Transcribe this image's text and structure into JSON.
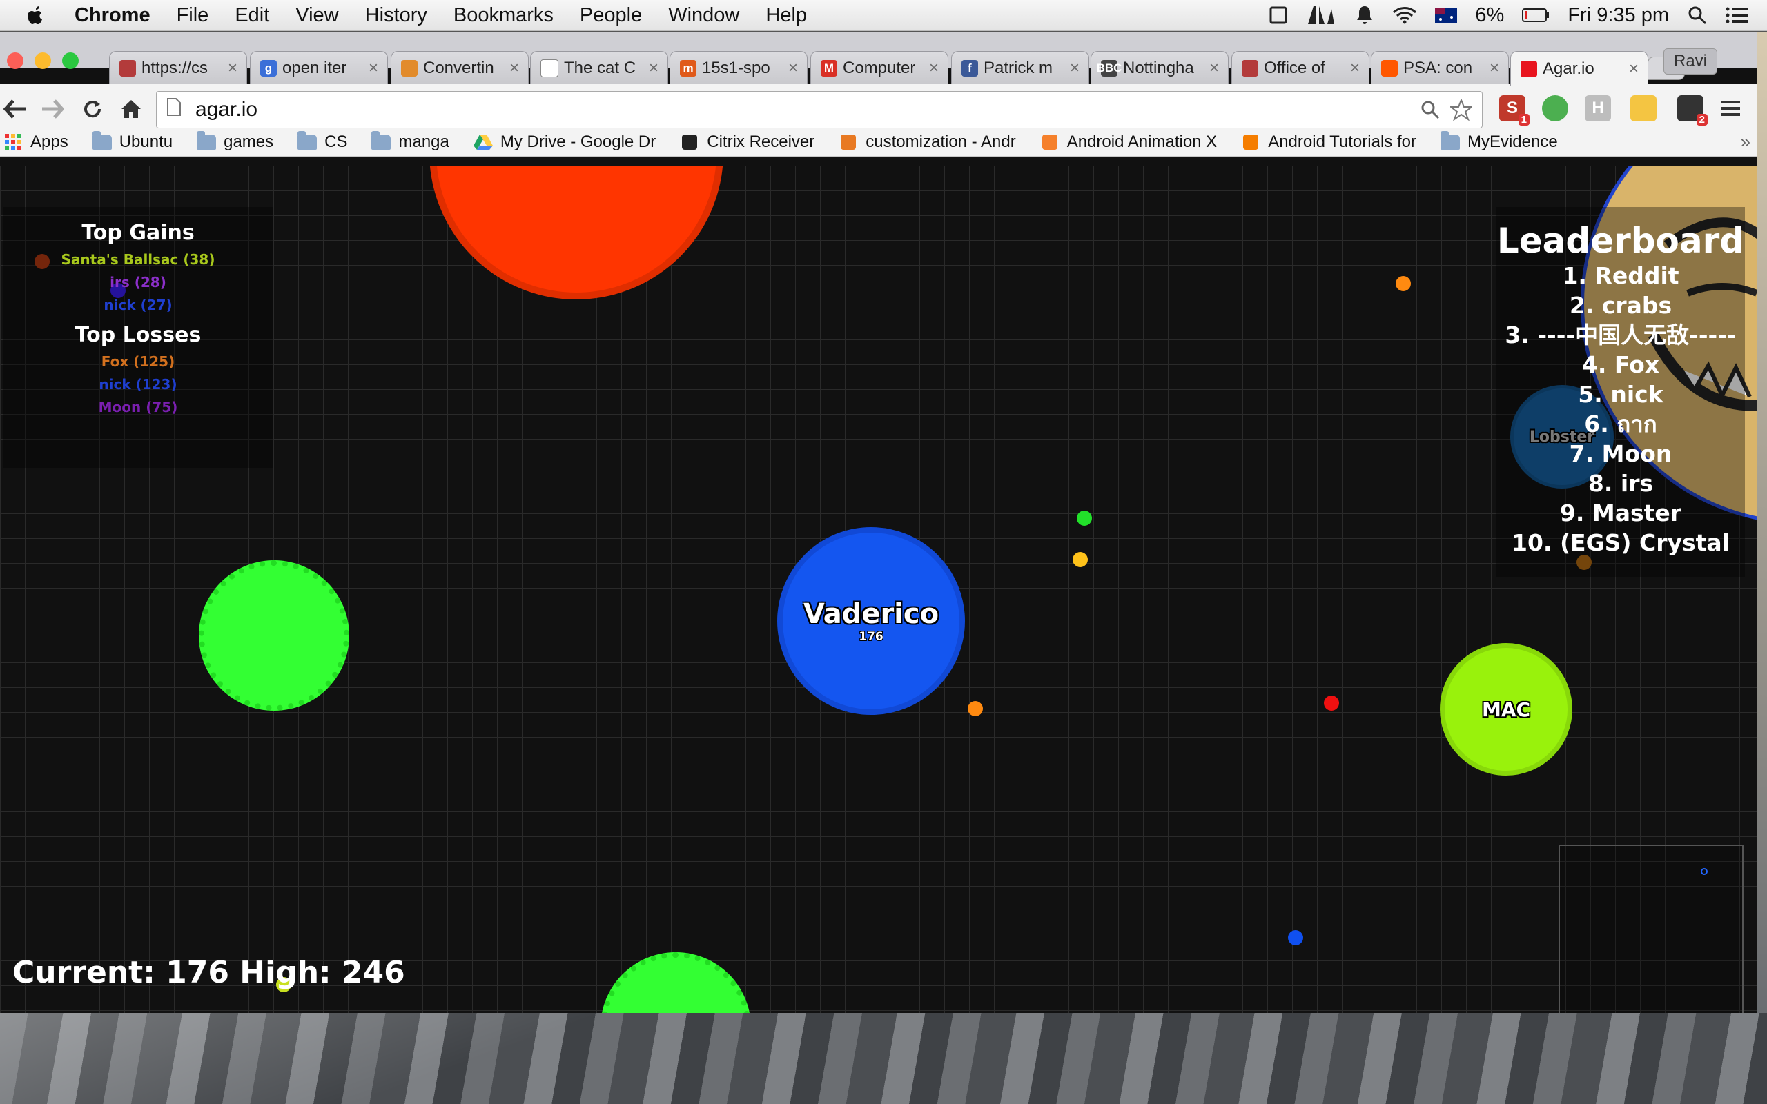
{
  "menubar": {
    "app_name": "Chrome",
    "menus": [
      "File",
      "Edit",
      "View",
      "History",
      "Bookmarks",
      "People",
      "Window",
      "Help"
    ],
    "battery": "6%",
    "clock": "Fri 9:35 pm"
  },
  "tabs": [
    {
      "title": "https://cs",
      "favicon_color": "#b33b3b",
      "favicon_glyph": ""
    },
    {
      "title": "open iter",
      "favicon_color": "#3b6fd8",
      "favicon_glyph": "g"
    },
    {
      "title": "Convertin",
      "favicon_color": "#e28b2b",
      "favicon_glyph": ""
    },
    {
      "title": "The cat C",
      "favicon_color": "#ffffff",
      "favicon_glyph": ""
    },
    {
      "title": "15s1-spo",
      "favicon_color": "#e05a1a",
      "favicon_glyph": "m"
    },
    {
      "title": "Computer",
      "favicon_color": "#d93025",
      "favicon_glyph": "M"
    },
    {
      "title": "Patrick m",
      "favicon_color": "#3b5998",
      "favicon_glyph": "f"
    },
    {
      "title": "Nottingha",
      "favicon_color": "#444444",
      "favicon_glyph": "BBC"
    },
    {
      "title": "Office of",
      "favicon_color": "#b33b3b",
      "favicon_glyph": ""
    },
    {
      "title": "PSA: con",
      "favicon_color": "#ff5700",
      "favicon_glyph": ""
    },
    {
      "title": "Agar.io",
      "favicon_color": "#e8141e",
      "favicon_glyph": "",
      "active": true
    }
  ],
  "profile_name": "Ravi",
  "address": {
    "url": "agar.io"
  },
  "extensions": [
    {
      "glyph": "S",
      "color": "#c0392b",
      "badge": "1"
    },
    {
      "glyph": "",
      "color": "#4caf50",
      "badge": ""
    },
    {
      "glyph": "H",
      "color": "#bdbdbd",
      "badge": ""
    },
    {
      "glyph": "",
      "color": "#f4c542",
      "badge": ""
    },
    {
      "glyph": "",
      "color": "#333333",
      "badge": "2"
    }
  ],
  "bookmarks": [
    {
      "label": "Apps",
      "icon": "apps-grid-icon"
    },
    {
      "label": "Ubuntu",
      "icon": "folder-icon"
    },
    {
      "label": "games",
      "icon": "folder-icon"
    },
    {
      "label": "CS",
      "icon": "folder-icon"
    },
    {
      "label": "manga",
      "icon": "folder-icon"
    },
    {
      "label": "My Drive - Google Dr",
      "icon": "google-drive-icon"
    },
    {
      "label": "Citrix Receiver",
      "icon": "citrix-icon"
    },
    {
      "label": "customization - Andr",
      "icon": "stackoverflow-icon"
    },
    {
      "label": "Android Animation X",
      "icon": "xda-icon"
    },
    {
      "label": "Android Tutorials for",
      "icon": "blogger-icon"
    },
    {
      "label": "MyEvidence",
      "icon": "folder-icon"
    }
  ],
  "game": {
    "stats": {
      "top_gains_title": "Top Gains",
      "top_gains": [
        {
          "text": "Santa's Ballsac (38)",
          "color": "#a8c81c"
        },
        {
          "text": "irs (28)",
          "color": "#8b2fc9"
        },
        {
          "text": "nick (27)",
          "color": "#1f3fcf"
        }
      ],
      "top_losses_title": "Top Losses",
      "top_losses": [
        {
          "text": "Fox (125)",
          "color": "#d2701e"
        },
        {
          "text": "nick (123)",
          "color": "#1f3fcf"
        },
        {
          "text": "Moon (75)",
          "color": "#7a1fb0"
        }
      ]
    },
    "leaderboard": {
      "title": "Leaderboard",
      "entries": [
        "1. Reddit",
        "2. crabs",
        "3. ----中国人无敌-----",
        "4. Fox",
        "5. nick",
        "6. ถาก",
        "7. Moon",
        "8. irs",
        "9. Master",
        "10. (EGS) Crystal"
      ]
    },
    "player": {
      "name": "Vaderico",
      "mass": "176",
      "color": "#1456f0"
    },
    "other_cells": [
      {
        "name": "MAC",
        "color": "#99f20c"
      },
      {
        "name": "Lobster",
        "color": "#1660a0"
      }
    ],
    "score": "Current: 176  High: 246"
  }
}
